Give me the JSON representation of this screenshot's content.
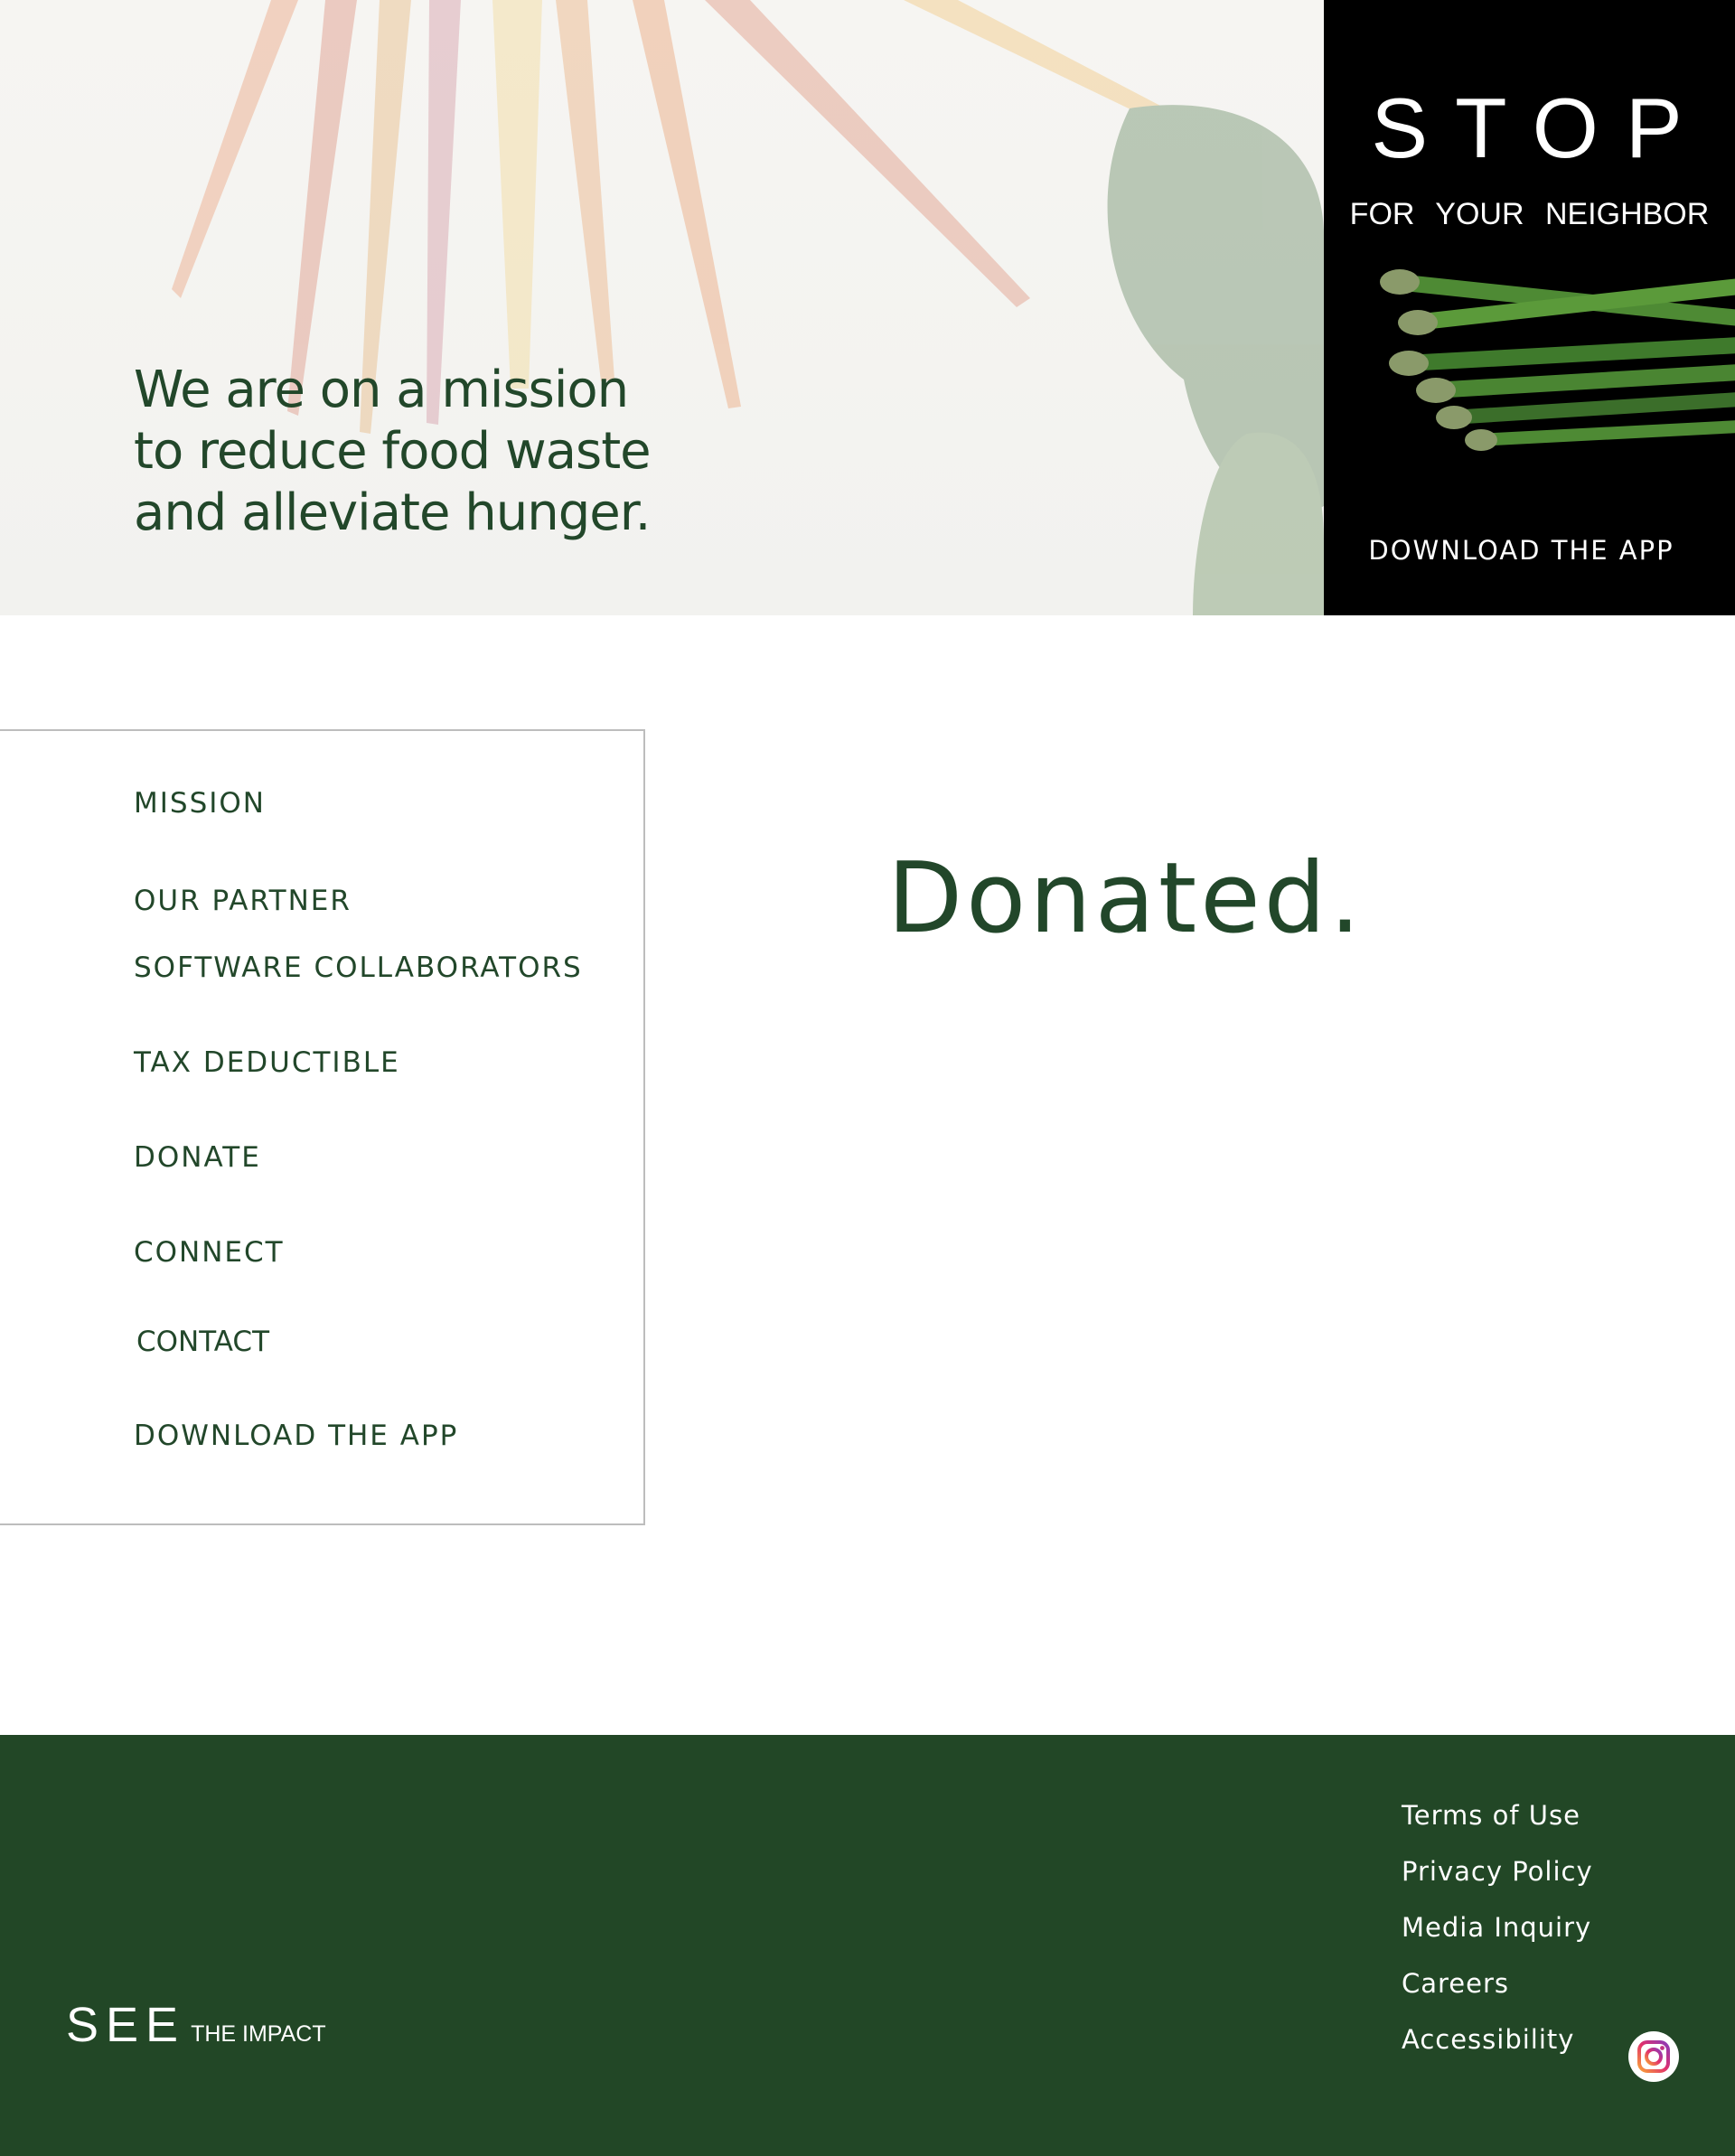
{
  "hero": {
    "tagline": "We are on a mission\nto reduce food waste\nand alleviate hunger."
  },
  "promo": {
    "headline": "STOP",
    "subline": "FOR YOUR NEIGHBOR",
    "cta": "DOWNLOAD THE APP"
  },
  "menu": {
    "items": [
      "MISSION",
      "OUR PARTNER",
      "SOFTWARE COLLABORATORS",
      "TAX DEDUCTIBLE",
      "DONATE",
      "CONNECT",
      "CONTACT",
      "DOWNLOAD THE APP"
    ]
  },
  "main": {
    "heading": "Donated."
  },
  "footer": {
    "brand_big": "SEE",
    "brand_small": "THE IMPACT",
    "links": [
      "Terms of Use",
      "Privacy Policy",
      "Media Inquiry",
      "Careers",
      "Accessibility"
    ],
    "social_icon": "instagram-icon"
  },
  "colors": {
    "brand_green": "#224726",
    "text_green": "#22472a",
    "promo_bg": "#000000"
  }
}
